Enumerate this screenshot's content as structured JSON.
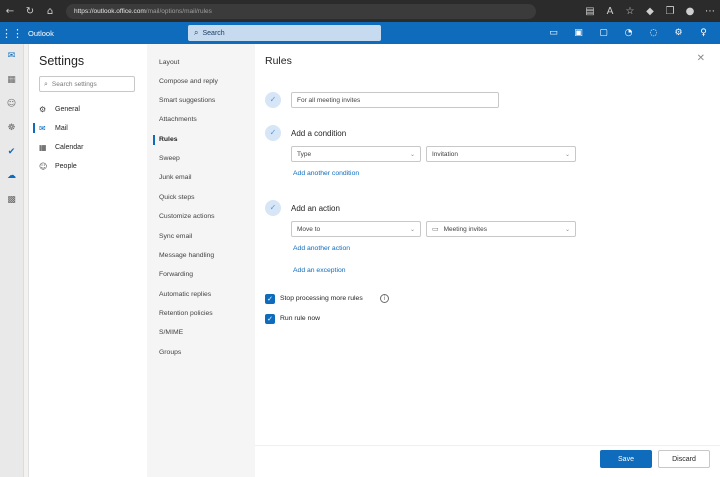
{
  "browser": {
    "url_host": "https://outlook.office.com",
    "url_path": "/mail/options/mail/rules"
  },
  "app": {
    "name": "Outlook",
    "search_placeholder": "Search"
  },
  "settings": {
    "title": "Settings",
    "search_placeholder": "Search settings",
    "categories": [
      {
        "label": "General",
        "icon": "gear-icon",
        "active": false
      },
      {
        "label": "Mail",
        "icon": "mail-icon",
        "active": true
      },
      {
        "label": "Calendar",
        "icon": "calendar-icon",
        "active": false
      },
      {
        "label": "People",
        "icon": "people-icon",
        "active": false
      }
    ]
  },
  "mail_menu": [
    "Layout",
    "Compose and reply",
    "Smart suggestions",
    "Attachments",
    "Rules",
    "Sweep",
    "Junk email",
    "Quick steps",
    "Customize actions",
    "Sync email",
    "Message handling",
    "Forwarding",
    "Automatic replies",
    "Retention policies",
    "S/MIME",
    "Groups"
  ],
  "mail_menu_active": "Rules",
  "rules": {
    "title": "Rules",
    "rule_name": "For all meeting invites",
    "condition_heading": "Add a condition",
    "condition_field": "Type",
    "condition_value": "Invitation",
    "add_condition_link": "Add another condition",
    "action_heading": "Add an action",
    "action_field": "Move to",
    "action_value": "Meeting invites",
    "add_action_link": "Add another action",
    "add_exception_link": "Add an exception",
    "stop_processing_label": "Stop processing more rules",
    "stop_processing_checked": true,
    "run_now_label": "Run rule now",
    "run_now_checked": true,
    "save_label": "Save",
    "discard_label": "Discard"
  },
  "colors": {
    "accent": "#0f6cbd",
    "browser_bar": "#2b2b2b"
  }
}
